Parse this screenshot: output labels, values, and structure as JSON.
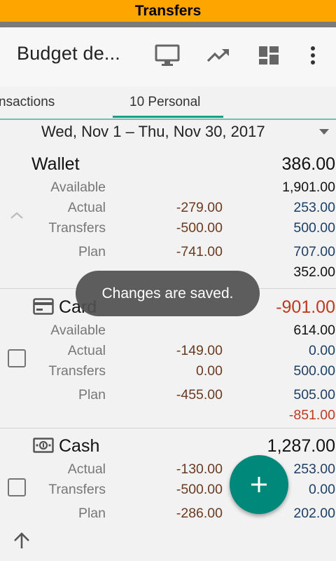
{
  "system_title": "Transfers",
  "appbar": {
    "title": "Budget de...",
    "icons": [
      "monitor-icon",
      "trending-up-icon",
      "dashboard-icon",
      "more-vert-icon"
    ]
  },
  "tabs": [
    {
      "label": "nsactions"
    },
    {
      "label": "10 Personal",
      "selected": true
    }
  ],
  "date_range": "Wed, Nov 1 – Thu, Nov 30, 2017",
  "accounts": [
    {
      "name": "Wallet",
      "total": "386.00",
      "rows": [
        {
          "label": "Available",
          "mid": "",
          "right": "1,901.00"
        },
        {
          "label": "Actual",
          "mid": "-279.00",
          "right": "253.00"
        },
        {
          "label": "Transfers",
          "mid": "-500.00",
          "right": "500.00"
        },
        {
          "label": "Plan",
          "mid": "-741.00",
          "right": "707.00"
        },
        {
          "label": "",
          "mid": "",
          "right": "352.00"
        }
      ]
    },
    {
      "name": "Card",
      "total": "-901.00",
      "rows": [
        {
          "label": "Available",
          "mid": "",
          "right": "614.00"
        },
        {
          "label": "Actual",
          "mid": "-149.00",
          "right": "0.00"
        },
        {
          "label": "Transfers",
          "mid": "0.00",
          "right": "500.00"
        },
        {
          "label": "Plan",
          "mid": "-455.00",
          "right": "505.00"
        },
        {
          "label": "",
          "mid": "",
          "right": "-851.00"
        }
      ]
    },
    {
      "name": "Cash",
      "total": "1,287.00",
      "rows": [
        {
          "label": "Actual",
          "mid": "-130.00",
          "right": "253.00"
        },
        {
          "label": "Transfers",
          "mid": "-500.00",
          "right": "0.00"
        },
        {
          "label": "Plan",
          "mid": "-286.00",
          "right": "202.00"
        }
      ]
    }
  ],
  "toast": "Changes are saved.",
  "colors": {
    "system_bar": "#ffa500",
    "accent": "#00897b",
    "negative": "#c0391f",
    "plan_mid": "#6b3a1f",
    "plan_right": "#1c3f66"
  }
}
